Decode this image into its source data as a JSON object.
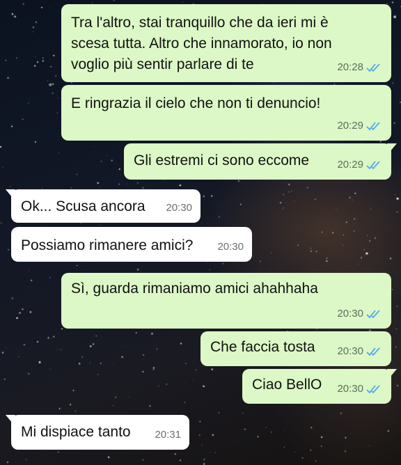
{
  "messages": [
    {
      "text": "Tra l'altro, stai tranquillo che da ieri mi è\nscesa tutta. Altro che innamorato, io non\nvoglio più sentir parlare di te",
      "time": "20:28"
    },
    {
      "text": "E ringrazia il cielo che non ti denuncio!",
      "time": "20:29"
    },
    {
      "text": "Gli estremi ci sono eccome",
      "time": "20:29"
    },
    {
      "text": "Ok... Scusa ancora",
      "time": "20:30"
    },
    {
      "text": "Possiamo rimanere amici?",
      "time": "20:30"
    },
    {
      "text": "Sì, guarda rimaniamo amici ahahhaha",
      "time": "20:30"
    },
    {
      "text": "Che faccia tosta",
      "time": "20:30"
    },
    {
      "text": "Ciao BellO",
      "time": "20:30"
    },
    {
      "text": "Mi dispiace tanto",
      "time": "20:31"
    }
  ],
  "colors": {
    "outgoing_bubble": "#dcf8c6",
    "incoming_bubble": "#ffffff",
    "read_ticks": "#4fa9f0"
  },
  "icons": {
    "read_receipt": "double-check-icon"
  }
}
